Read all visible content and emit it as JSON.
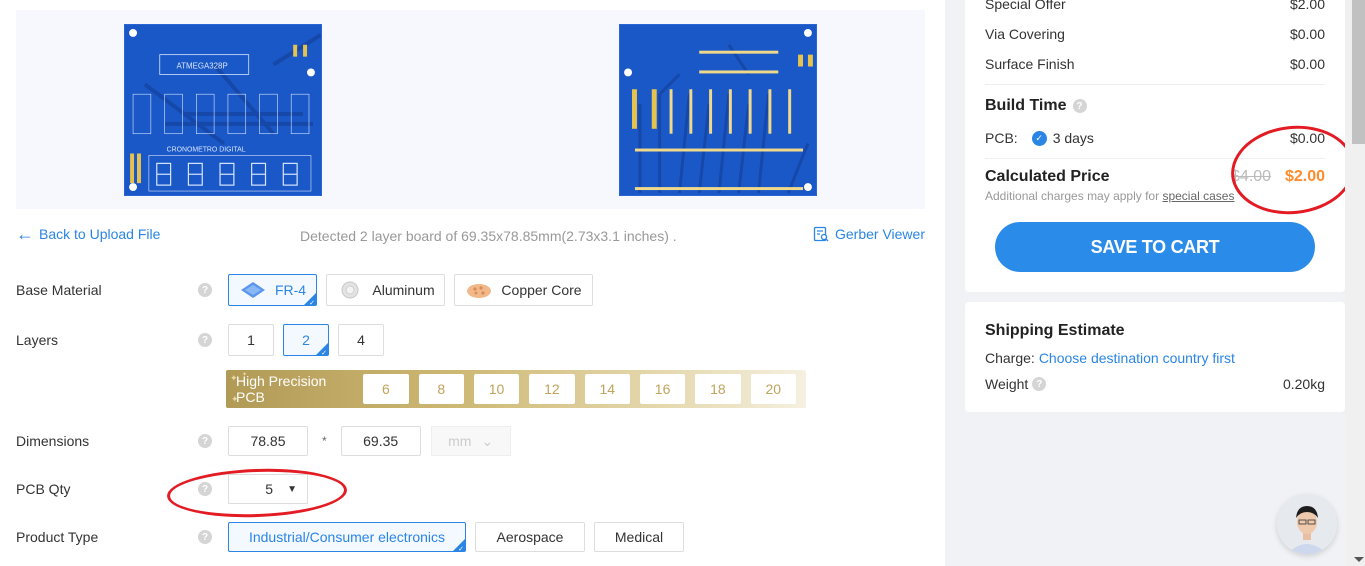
{
  "preview": {
    "top_board_label": "ATMEGA328P",
    "top_board_title": "CRONOMETRO DIGITAL"
  },
  "toolbar": {
    "back_label": "Back to Upload File",
    "detected_text": "Detected 2 layer board of 69.35x78.85mm(2.73x3.1 inches) .",
    "gerber_label": "Gerber Viewer"
  },
  "form": {
    "base_material": {
      "label": "Base Material",
      "options": [
        {
          "label": "FR-4",
          "icon": "fr4-icon",
          "selected": true
        },
        {
          "label": "Aluminum",
          "icon": "aluminum-icon",
          "selected": false
        },
        {
          "label": "Copper Core",
          "icon": "copper-core-icon",
          "selected": false
        }
      ]
    },
    "layers": {
      "label": "Layers",
      "options": [
        "1",
        "2",
        "4"
      ],
      "selected": "2",
      "high_precision_label": "High Precision PCB",
      "high_precision_options": [
        "6",
        "8",
        "10",
        "12",
        "14",
        "16",
        "18",
        "20"
      ]
    },
    "dimensions": {
      "label": "Dimensions",
      "width": "78.85",
      "separator": "*",
      "height": "69.35",
      "unit": "mm"
    },
    "pcb_qty": {
      "label": "PCB Qty",
      "value": "5"
    },
    "product_type": {
      "label": "Product Type",
      "options": [
        {
          "label": "Industrial/Consumer electronics",
          "selected": true
        },
        {
          "label": "Aerospace",
          "selected": false
        },
        {
          "label": "Medical",
          "selected": false
        }
      ]
    }
  },
  "price_card": {
    "lines": [
      {
        "label": "Special Offer",
        "value": "$2.00"
      },
      {
        "label": "Via Covering",
        "value": "$0.00"
      },
      {
        "label": "Surface Finish",
        "value": "$0.00"
      }
    ],
    "build_time_title": "Build Time",
    "build_time": {
      "label": "PCB:",
      "option": "3 days",
      "value": "$0.00"
    },
    "calculated_title": "Calculated Price",
    "old_price": "$4.00",
    "new_price": "$2.00",
    "note_prefix": "Additional charges may apply for",
    "note_link": "special cases",
    "save_button": "SAVE TO CART"
  },
  "shipping_card": {
    "title": "Shipping Estimate",
    "charge_label": "Charge:",
    "charge_link": "Choose destination country first",
    "weight_label": "Weight",
    "weight_value": "0.20kg"
  },
  "colors": {
    "accent": "#2b85e4",
    "price": "#ff8b2b",
    "annotation": "#e31b23",
    "pcb_blue": "#1b58c7"
  }
}
